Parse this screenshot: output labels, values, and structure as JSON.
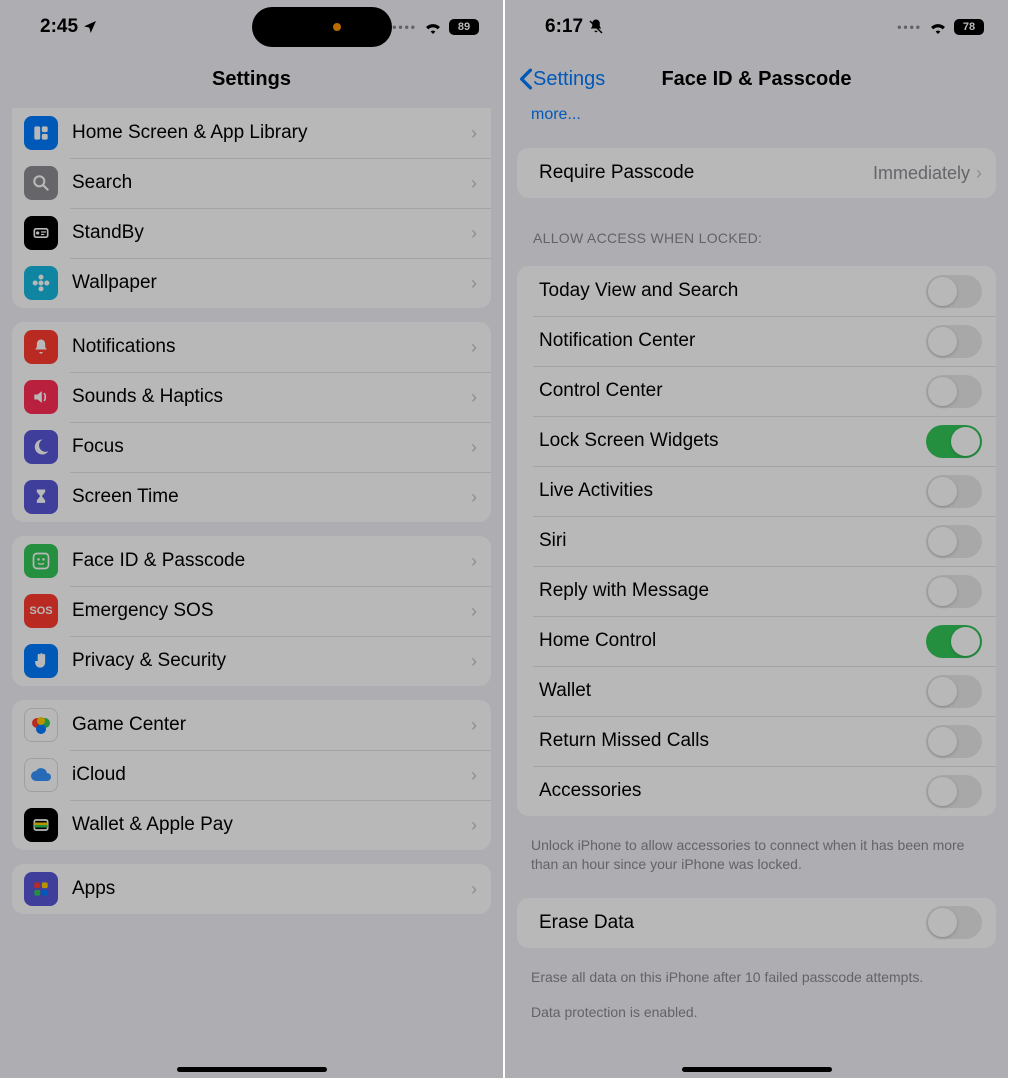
{
  "left": {
    "status": {
      "time": "2:45",
      "battery": "89"
    },
    "title": "Settings",
    "group1": [
      {
        "name": "home-screen",
        "label": "Home Screen & App Library",
        "icon": "grid",
        "bg": "#007aff"
      },
      {
        "name": "search",
        "label": "Search",
        "icon": "search",
        "bg": "#8e8e93"
      },
      {
        "name": "standby",
        "label": "StandBy",
        "icon": "standby",
        "bg": "#000000"
      },
      {
        "name": "wallpaper",
        "label": "Wallpaper",
        "icon": "flower",
        "bg": "#16b9e0"
      }
    ],
    "group2": [
      {
        "name": "notifications",
        "label": "Notifications",
        "icon": "bell",
        "bg": "#ff3b30"
      },
      {
        "name": "sounds",
        "label": "Sounds & Haptics",
        "icon": "speaker",
        "bg": "#ff2d55"
      },
      {
        "name": "focus",
        "label": "Focus",
        "icon": "moon",
        "bg": "#5856d6"
      },
      {
        "name": "screen-time",
        "label": "Screen Time",
        "icon": "hourglass",
        "bg": "#5856d6"
      }
    ],
    "group3": [
      {
        "name": "face-id",
        "label": "Face ID & Passcode",
        "icon": "face",
        "bg": "#34c759",
        "highlight": true
      },
      {
        "name": "emergency",
        "label": "Emergency SOS",
        "icon": "sos",
        "bg": "#ff3b30"
      },
      {
        "name": "privacy",
        "label": "Privacy & Security",
        "icon": "hand",
        "bg": "#007aff"
      }
    ],
    "group4": [
      {
        "name": "game-center",
        "label": "Game Center",
        "icon": "bubbles",
        "bg": "#ffffff"
      },
      {
        "name": "icloud",
        "label": "iCloud",
        "icon": "cloud",
        "bg": "#ffffff"
      },
      {
        "name": "wallet-pay",
        "label": "Wallet & Apple Pay",
        "icon": "wallet",
        "bg": "#000000"
      }
    ],
    "group5": [
      {
        "name": "apps",
        "label": "Apps",
        "icon": "appgrid",
        "bg": "#5856d6"
      }
    ]
  },
  "right": {
    "status": {
      "time": "6:17",
      "battery": "78"
    },
    "back": "Settings",
    "title": "Face ID & Passcode",
    "more": "more...",
    "require": {
      "label": "Require Passcode",
      "value": "Immediately"
    },
    "section_header": "Allow Access When Locked:",
    "toggles": [
      {
        "name": "today-view",
        "label": "Today View and Search",
        "on": false
      },
      {
        "name": "notification-center",
        "label": "Notification Center",
        "on": false
      },
      {
        "name": "control-center",
        "label": "Control Center",
        "on": false
      },
      {
        "name": "lock-widgets",
        "label": "Lock Screen Widgets",
        "on": true
      },
      {
        "name": "live-activities",
        "label": "Live Activities",
        "on": false
      },
      {
        "name": "siri",
        "label": "Siri",
        "on": false,
        "highlight": true
      },
      {
        "name": "reply-message",
        "label": "Reply with Message",
        "on": false
      },
      {
        "name": "home-control",
        "label": "Home Control",
        "on": true
      },
      {
        "name": "wallet",
        "label": "Wallet",
        "on": false
      },
      {
        "name": "return-calls",
        "label": "Return Missed Calls",
        "on": false
      },
      {
        "name": "accessories",
        "label": "Accessories",
        "on": false
      }
    ],
    "accessories_footer": "Unlock iPhone to allow accessories to connect when it has been more than an hour since your iPhone was locked.",
    "erase": {
      "label": "Erase Data",
      "on": false
    },
    "erase_footer": "Erase all data on this iPhone after 10 failed passcode attempts.",
    "data_protection": "Data protection is enabled."
  }
}
